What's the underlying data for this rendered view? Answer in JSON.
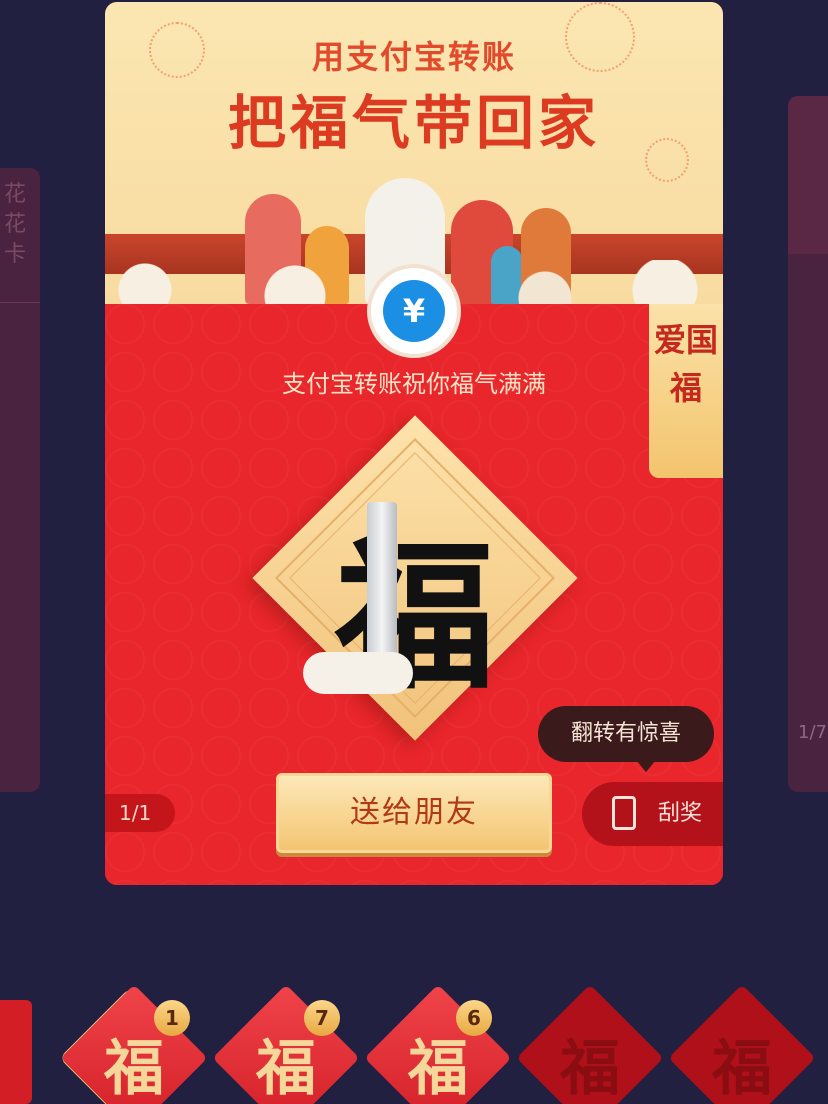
{
  "banner": {
    "line1": "用支付宝转账",
    "line2": "把福气带回家"
  },
  "swap_icon_symbol": "¥",
  "tagline": "支付宝转账祝你福气满满",
  "ribbon_text": "爱国福",
  "fu_character": "福",
  "pager": "1/1",
  "send_button_label": "送给朋友",
  "tooltip": "翻转有惊喜",
  "scratch_label": "刮奖",
  "left_card_text": "花花卡",
  "right_card_pager": "1/7",
  "fu_tiles": [
    {
      "label": "福",
      "count": "1",
      "selected": true
    },
    {
      "label": "福",
      "count": "7",
      "selected": false
    },
    {
      "label": "福",
      "count": "6",
      "selected": false
    },
    {
      "label": "福",
      "count": "",
      "selected": false
    },
    {
      "label": "福",
      "count": "",
      "selected": false
    }
  ],
  "colors": {
    "background": "#222040",
    "card_red": "#e8262b",
    "gold": "#f3c572",
    "banner_cream": "#fbe6b2",
    "icon_blue": "#1a8fe3"
  },
  "icons": {
    "transfer": "transfer-yuan-icon",
    "scratch": "phone-icon"
  }
}
